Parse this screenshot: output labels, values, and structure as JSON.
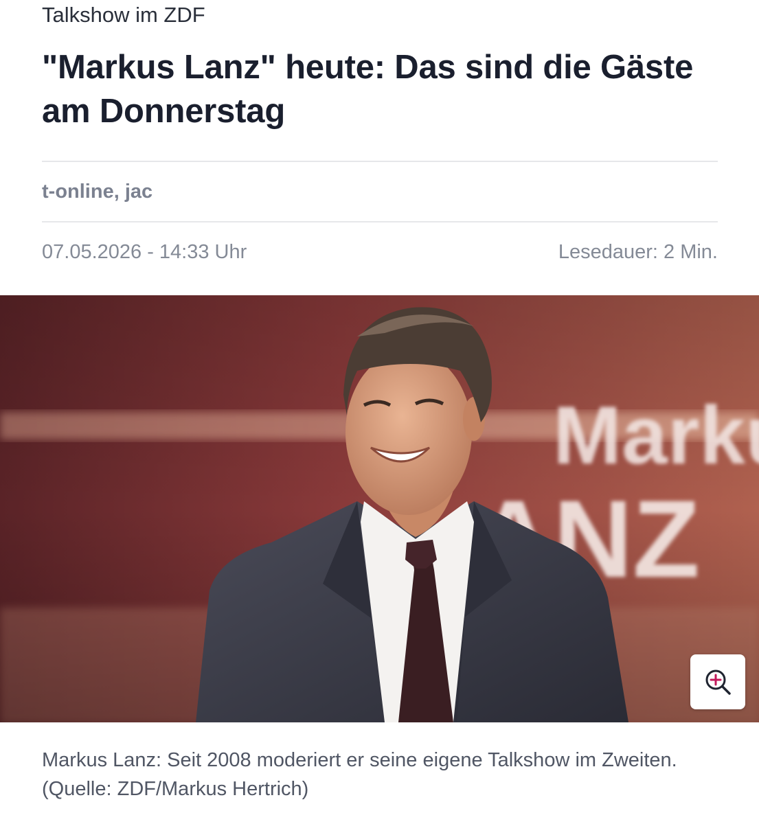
{
  "article": {
    "kicker": "Talkshow im ZDF",
    "headline": "\"Markus Lanz\" heute: Das sind die Gäste am Donnerstag",
    "author": "t-online, jac",
    "date": "07.05.2026 - 14:33 Uhr",
    "reading_time": "Lesedauer: 2 Min."
  },
  "image": {
    "backdrop_word_1": "Marku",
    "backdrop_word_2": "ANZ",
    "zoom_icon": "zoom-in-icon",
    "caption": "Markus Lanz: Seit 2008 moderiert er seine eigene Talkshow im Zweiten. (Quelle: ZDF/Markus Hertrich)"
  },
  "colors": {
    "text_dark": "#1a1f2e",
    "text_muted": "#848a96",
    "accent_magenta": "#c2185b",
    "backdrop_red": "#7a2c30"
  }
}
